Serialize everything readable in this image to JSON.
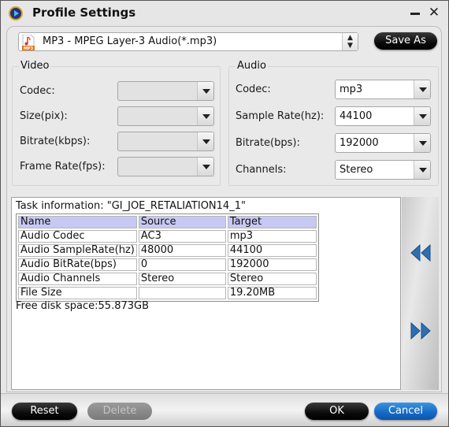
{
  "window": {
    "title": "Profile Settings",
    "minimize_label": "minimize",
    "close_label": "✕"
  },
  "profile": {
    "selected": "MP3 - MPEG Layer-3 Audio(*.mp3)",
    "icon_badge": "MP3",
    "save_as_label": "Save As"
  },
  "video": {
    "title": "Video",
    "fields": [
      {
        "label": "Codec:",
        "value": ""
      },
      {
        "label": "Size(pix):",
        "value": ""
      },
      {
        "label": "Bitrate(kbps):",
        "value": ""
      },
      {
        "label": "Frame Rate(fps):",
        "value": ""
      }
    ]
  },
  "audio": {
    "title": "Audio",
    "fields": [
      {
        "label": "Codec:",
        "value": "mp3"
      },
      {
        "label": "Sample Rate(hz):",
        "value": "44100"
      },
      {
        "label": "Bitrate(bps):",
        "value": "192000"
      },
      {
        "label": "Channels:",
        "value": "Stereo"
      }
    ]
  },
  "task": {
    "info_label": "Task information: \"GI_JOE_RETALIATION14_1\"",
    "columns": [
      "Name",
      "Source",
      "Target"
    ],
    "rows": [
      [
        "Audio Codec",
        "AC3",
        "mp3"
      ],
      [
        "Audio SampleRate(hz)",
        "48000",
        "44100"
      ],
      [
        "Audio BitRate(bps)",
        "0",
        "192000"
      ],
      [
        "Audio Channels",
        "Stereo",
        "Stereo"
      ],
      [
        "File Size",
        "",
        "19.20MB"
      ]
    ],
    "free_space": "Free disk space:55.873GB"
  },
  "buttons": {
    "reset": "Reset",
    "delete": "Delete",
    "ok": "OK",
    "cancel": "Cancel"
  },
  "colors": {
    "table_header_bg": "#c8c8f4",
    "cancel_blue": "#1468c4",
    "arrow_blue": "#2f6fb0"
  }
}
